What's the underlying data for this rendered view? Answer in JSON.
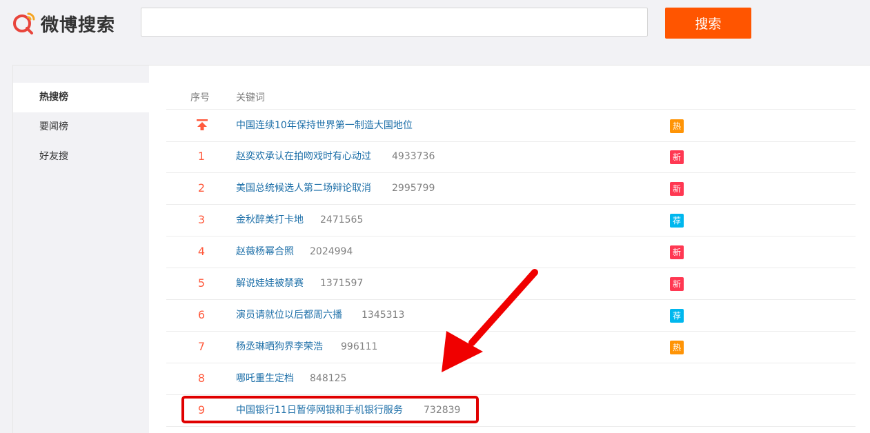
{
  "header": {
    "logo_text": "微博搜索",
    "search_placeholder": "",
    "search_button": "搜索",
    "accent": "#ff5500"
  },
  "sidebar": {
    "items": [
      {
        "label": "热搜榜",
        "active": true
      },
      {
        "label": "要闻榜",
        "active": false
      },
      {
        "label": "好友搜",
        "active": false
      }
    ]
  },
  "table": {
    "headers": {
      "rank": "序号",
      "keyword": "关键词"
    },
    "pinned": {
      "keyword": "中国连续10年保持世界第一制造大国地位",
      "badge": "热",
      "badge_color": "#ff9406",
      "icon": "pin-top-icon"
    },
    "rows": [
      {
        "rank": "1",
        "keyword": "赵奕欢承认在拍吻戏时有心动过",
        "count": "4933736",
        "badge": "新",
        "badge_color": "#ff3852"
      },
      {
        "rank": "2",
        "keyword": "美国总统候选人第二场辩论取消",
        "count": "2995799",
        "badge": "新",
        "badge_color": "#ff3852"
      },
      {
        "rank": "3",
        "keyword": "金秋醉美打卡地",
        "count": "2471565",
        "badge": "荐",
        "badge_color": "#00b7ee"
      },
      {
        "rank": "4",
        "keyword": "赵薇杨幂合照",
        "count": "2024994",
        "badge": "新",
        "badge_color": "#ff3852"
      },
      {
        "rank": "5",
        "keyword": "解说娃娃被禁赛",
        "count": "1371597",
        "badge": "新",
        "badge_color": "#ff3852"
      },
      {
        "rank": "6",
        "keyword": "演员请就位以后都周六播",
        "count": "1345313",
        "badge": "荐",
        "badge_color": "#00b7ee"
      },
      {
        "rank": "7",
        "keyword": "杨丞琳晒狗界李荣浩",
        "count": "996111",
        "badge": "热",
        "badge_color": "#ff9406"
      },
      {
        "rank": "8",
        "keyword": "哪吒重生定档",
        "count": "848125",
        "badge": "",
        "badge_color": ""
      },
      {
        "rank": "9",
        "keyword": "中国银行11日暂停网银和手机银行服务",
        "count": "732839",
        "badge": "",
        "badge_color": ""
      }
    ]
  },
  "annotation": {
    "highlight_color": "#e00000",
    "arrow_color": "#f00000"
  }
}
